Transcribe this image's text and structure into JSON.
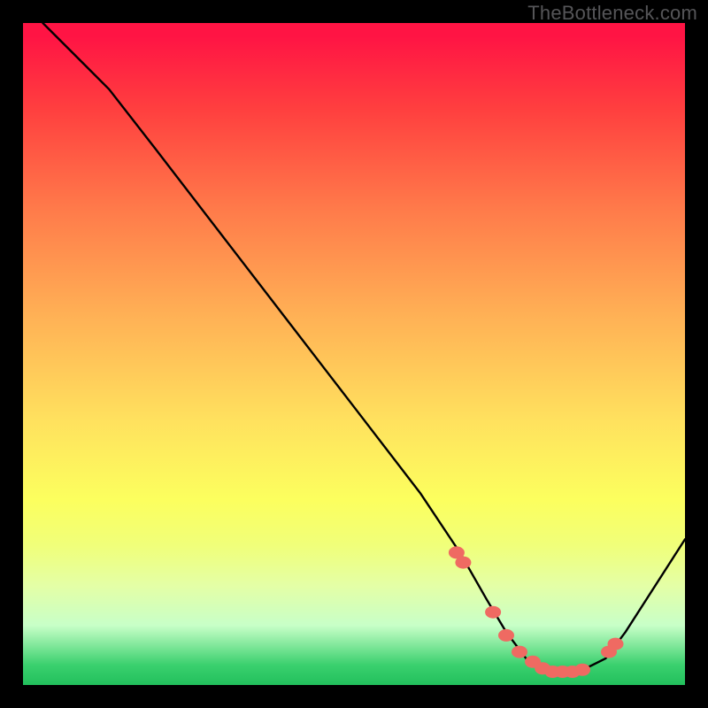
{
  "attribution": "TheBottleneck.com",
  "chart_data": {
    "type": "line",
    "title": "",
    "xlabel": "",
    "ylabel": "",
    "xlim": [
      0,
      100
    ],
    "ylim": [
      0,
      100
    ],
    "series": [
      {
        "name": "bottleneck-curve",
        "x": [
          3,
          9,
          13,
          20,
          30,
          40,
          50,
          60,
          66,
          70,
          73,
          76,
          80,
          84,
          88,
          91,
          100
        ],
        "y": [
          100,
          94,
          90,
          81,
          68,
          55,
          42,
          29,
          20,
          13,
          8,
          4,
          2,
          2,
          4,
          8,
          22
        ]
      }
    ],
    "markers": {
      "name": "highlight-dots",
      "color": "#ef6a62",
      "points_x": [
        65.5,
        66.5,
        71,
        73,
        75,
        77,
        78.5,
        80,
        81.5,
        83,
        84.5,
        88.5,
        89.5
      ],
      "points_y": [
        20,
        18.5,
        11,
        7.5,
        5,
        3.5,
        2.5,
        2,
        2,
        2,
        2.3,
        5,
        6.2
      ]
    },
    "background_gradient": {
      "top": "#ff1444",
      "mid_upper": "#ffb055",
      "mid": "#fcff5e",
      "mid_lower": "#c8ffc8",
      "bottom": "#22c05c"
    }
  }
}
